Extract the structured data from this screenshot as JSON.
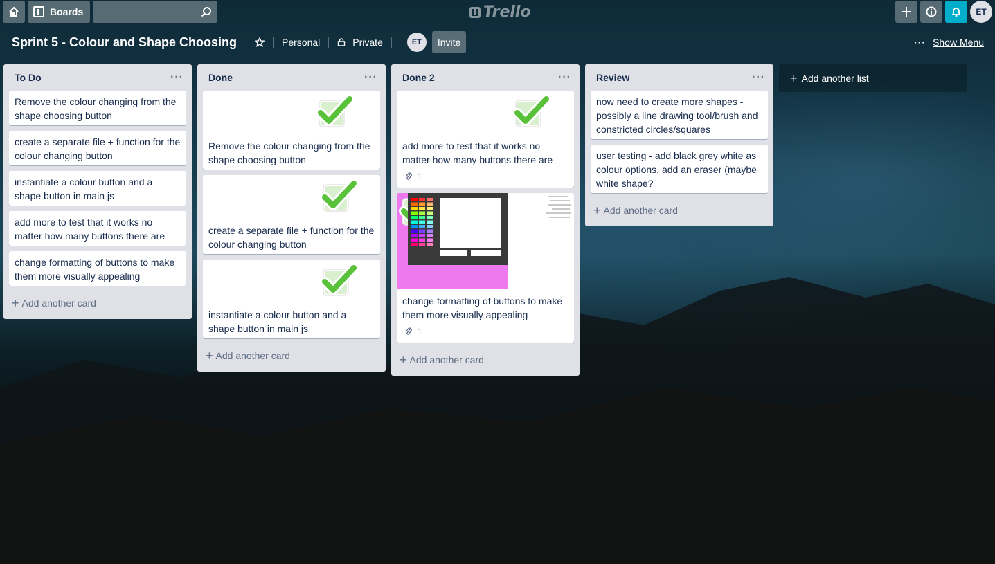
{
  "header": {
    "boards_label": "Boards",
    "logo_text": "Trello",
    "avatar_initials": "ET"
  },
  "board": {
    "title": "Sprint 5 - Colour and Shape Choosing",
    "team": "Personal",
    "visibility": "Private",
    "member_initials": "ET",
    "invite_label": "Invite",
    "show_menu_label": "Show Menu"
  },
  "lists": [
    {
      "title": "To Do",
      "cards": [
        {
          "text": "Remove the colour changing from the shape choosing button"
        },
        {
          "text": "create a separate file + function for the colour changing button"
        },
        {
          "text": "instantiate a colour button and a shape button in main js"
        },
        {
          "text": "add more to test that it works no matter how many buttons there are"
        },
        {
          "text": "change formatting of buttons to make them more visually appealing"
        }
      ],
      "add_card": "Add another card"
    },
    {
      "title": "Done",
      "cards": [
        {
          "text": "Remove the colour changing from the shape choosing button",
          "sticker": "check-sticker"
        },
        {
          "text": "create a separate file + function for the colour changing button",
          "sticker": "check-sticker"
        },
        {
          "text": "instantiate a colour button and a shape button in main js",
          "sticker": "check-sticker"
        }
      ],
      "add_card": "Add another card"
    },
    {
      "title": "Done 2",
      "cards": [
        {
          "text": "add more to test that it works no matter how many buttons there are",
          "sticker": "check-sticker",
          "attachments": "1"
        },
        {
          "text": "change formatting of buttons to make them more visually appealing",
          "cover": "screenshot-cover",
          "sticker": "check-sticker",
          "attachments": "1"
        }
      ],
      "add_card": "Add another card"
    },
    {
      "title": "Review",
      "cards": [
        {
          "text": "now need to create more shapes - possibly a line drawing tool/brush and constricted circles/squares"
        },
        {
          "text": "user testing - add black grey white as colour options, add an eraser (maybe white shape?"
        }
      ],
      "add_card": "Add another card"
    }
  ],
  "add_list_label": "Add another list",
  "colors": {
    "list_bg": "#dfe1e6",
    "check_green": "#5ac13a",
    "notification": "#00aecc",
    "cover_pink": "#ee78ee"
  }
}
